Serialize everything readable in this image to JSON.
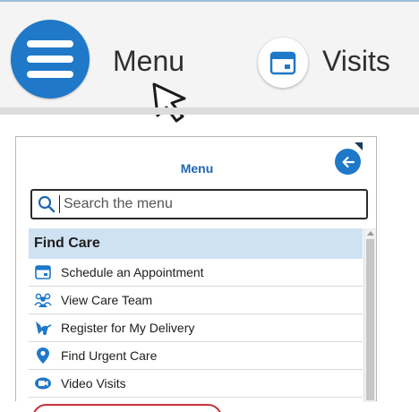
{
  "top_bar": {
    "menu_label": "Menu",
    "visits_label": "Visits",
    "menu_icon": "hamburger-icon",
    "visits_icon": "calendar-icon",
    "cursor_icon": "pointer-cursor-icon"
  },
  "menu_panel": {
    "title": "Menu",
    "back_icon": "arrow-left-icon",
    "search": {
      "placeholder": "Search the menu",
      "icon": "search-icon"
    },
    "section_header": "Find Care",
    "items": [
      {
        "label": "Schedule an Appointment",
        "icon": "calendar-icon"
      },
      {
        "label": "View Care Team",
        "icon": "care-team-icon"
      },
      {
        "label": "Register for My Delivery",
        "icon": "stork-icon"
      },
      {
        "label": "Find Urgent Care",
        "icon": "location-pin-icon"
      },
      {
        "label": "Video Visits",
        "icon": "video-icon"
      }
    ]
  },
  "colors": {
    "accent_blue": "#1f78c8",
    "title_blue": "#1f67b1",
    "section_bg": "#cfe2f3",
    "highlight_red": "#c8323c"
  }
}
